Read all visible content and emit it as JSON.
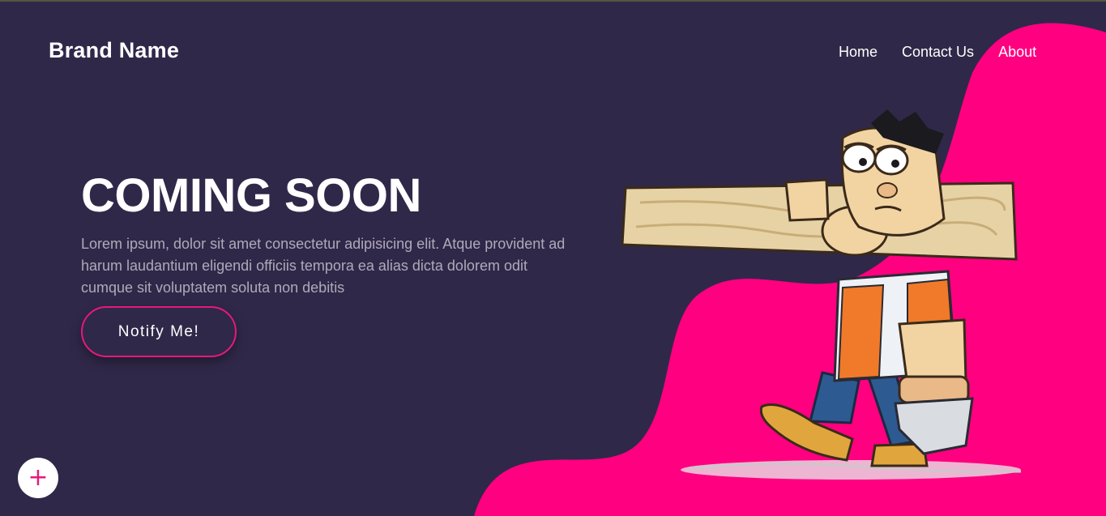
{
  "brand": {
    "name": "Brand Name"
  },
  "nav": {
    "items": [
      {
        "label": "Home"
      },
      {
        "label": "Contact Us"
      },
      {
        "label": "About"
      }
    ]
  },
  "hero": {
    "title": "COMING SOON",
    "description": "Lorem ipsum, dolor sit amet consectetur adipisicing elit. Atque provident ad harum laudantium eligendi officiis tempora ea alias dicta dolorem odit cumque sit voluptatem soluta non debitis",
    "cta_label": "Notify Me!"
  },
  "fab": {
    "icon": "plus-icon",
    "symbol": "+"
  },
  "illustration": {
    "subject": "cartoon-carpenter-carrying-plank"
  },
  "colors": {
    "background": "#302849",
    "accent": "#ff0080",
    "text": "#ffffff",
    "muted": "#b0a9b9"
  }
}
